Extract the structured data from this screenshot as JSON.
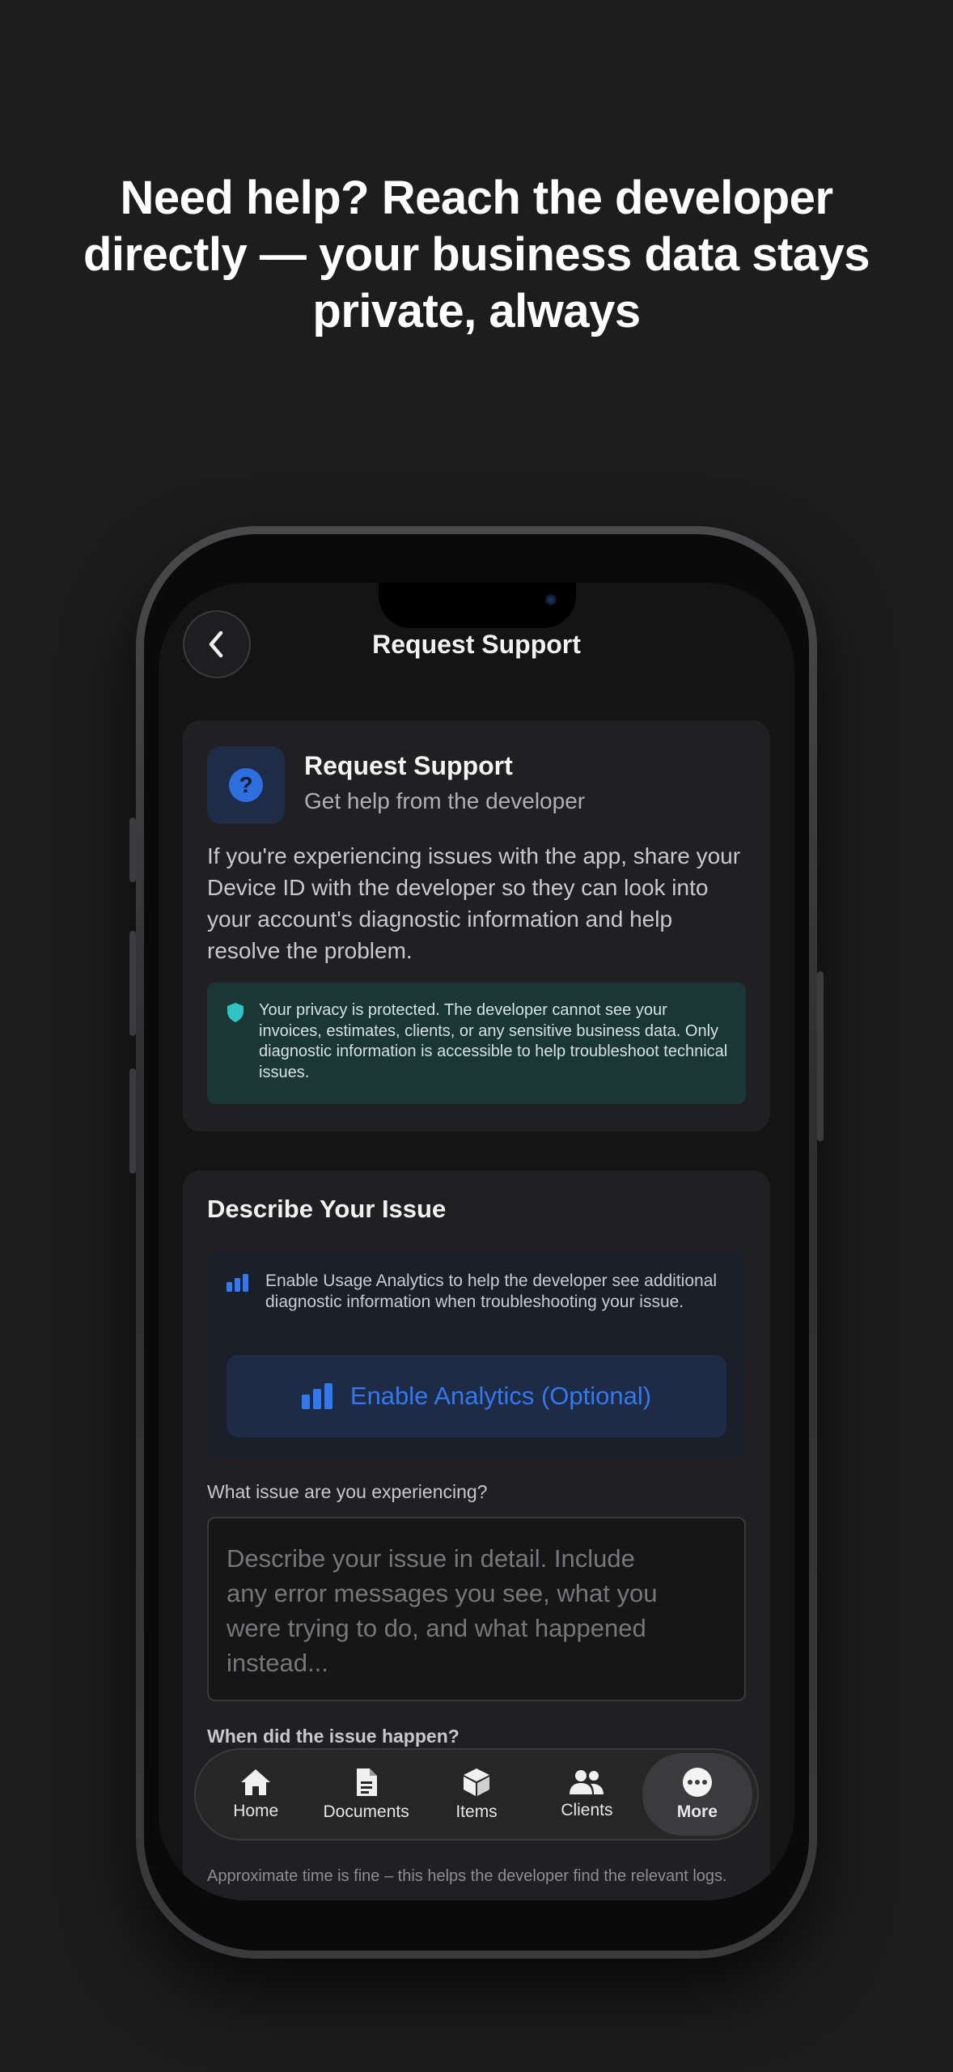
{
  "headline": "Need help? Reach the developer directly — your business data stays private, always",
  "nav": {
    "title": "Request Support"
  },
  "support_card": {
    "title": "Request Support",
    "subtitle": "Get help from the developer",
    "body": "If you're experiencing issues with the app, share your Device ID with the developer so they can look into your account's diagnostic information and help resolve the problem.",
    "privacy_note": "Your privacy is protected. The developer cannot see your invoices, estimates, clients, or any sensitive business data. Only diagnostic information is accessible to help troubleshoot technical issues."
  },
  "issue_card": {
    "title": "Describe Your Issue",
    "analytics_note": "Enable Usage Analytics to help the developer see additional diagnostic information when troubleshooting your issue.",
    "analytics_button": "Enable Analytics (Optional)",
    "issue_label": "What issue are you experiencing?",
    "issue_placeholder": "Describe your issue in detail. Include any error messages you see, what you were trying to do, and what happened instead...",
    "when_label": "When did the issue happen?",
    "when_hint": "Approximate time is fine – this helps the developer find the relevant logs."
  },
  "tabs": [
    {
      "label": "Home",
      "icon": "house-icon"
    },
    {
      "label": "Documents",
      "icon": "document-icon"
    },
    {
      "label": "Items",
      "icon": "box-icon"
    },
    {
      "label": "Clients",
      "icon": "people-icon"
    },
    {
      "label": "More",
      "icon": "more-icon",
      "active": true
    }
  ],
  "colors": {
    "accent": "#3478f0",
    "privacy_bg": "#1b3735",
    "shield": "#2ec4c4"
  }
}
